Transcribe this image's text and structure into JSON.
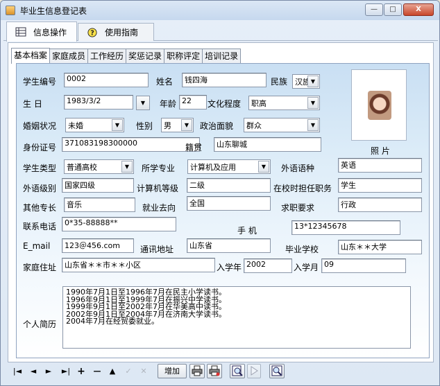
{
  "window": {
    "title": "毕业生信息登记表",
    "minimize": "—",
    "maximize": "□",
    "close": "X"
  },
  "main_tabs": [
    {
      "label": "信息操作",
      "icon": "table-icon"
    },
    {
      "label": "使用指南",
      "icon": "help-icon"
    }
  ],
  "sub_tabs": [
    "基本档案",
    "家庭成员",
    "工作经历",
    "奖惩记录",
    "职称评定",
    "培训记录"
  ],
  "form": {
    "student_id_label": "学生编号",
    "student_id": "0002",
    "name_label": "姓名",
    "name": "钱四海",
    "ethnicity_label": "民族",
    "ethnicity": "汉族",
    "birth_label": "生 日",
    "birth": "1983/3/2",
    "age_label": "年龄",
    "age": "22",
    "education_label": "文化程度",
    "education": "职高",
    "marital_label": "婚姻状况",
    "marital": "未婚",
    "gender_label": "性别",
    "gender": "男",
    "political_label": "政治面貌",
    "political": "群众",
    "idcard_label": "身份证号",
    "idcard": "371083198300000",
    "origin_label": "籍贯",
    "origin": "山东聊城",
    "photo_label": "照  片",
    "student_type_label": "学生类型",
    "student_type": "普通高校",
    "major_label": "所学专业",
    "major": "计算机及应用",
    "language_label": "外语语种",
    "language": "英语",
    "lang_level_label": "外语级别",
    "lang_level": "国家四级",
    "computer_level_label": "计算机等级",
    "computer_level": "二级",
    "school_duty_label": "在校时担任职务",
    "school_duty": "学生",
    "skills_label": "其他专长",
    "skills": "音乐",
    "employment_label": "就业去向",
    "employment": "全国",
    "job_req_label": "求职要求",
    "job_req": "行政",
    "phone_label": "联系电话",
    "phone": "0*35-88888**",
    "mobile_label": "手    机",
    "mobile": "13*12345678",
    "email_label": "E_mail",
    "email": "123＠456.com",
    "address_label": "通讯地址",
    "address": "山东省",
    "grad_school_label": "毕业学校",
    "grad_school": "山东＊＊大学",
    "home_label": "家庭住址",
    "home": "山东省＊＊市＊＊小区",
    "enroll_year_label": "入学年",
    "enroll_year": "2002",
    "enroll_month_label": "入学月",
    "enroll_month": "09",
    "resume_label": "个人简历",
    "resume": [
      "1990年7月1日至1996年7月在民主小学读书。",
      "1996年9月1日至1999年7月在振兴中学读书。",
      "1999年9月1日至2002年7月在华美高中读书。",
      "2002年9月1日至2004年7月在济南大学读书。",
      "2004年7月在经贸委就业。"
    ]
  },
  "toolbar": {
    "first": "|◄",
    "prev": "◄",
    "next": "►",
    "last": "►|",
    "add": "+",
    "delete": "—",
    "edit": "▲",
    "save": "✓",
    "cancel": "✕",
    "add_button": "增加"
  }
}
